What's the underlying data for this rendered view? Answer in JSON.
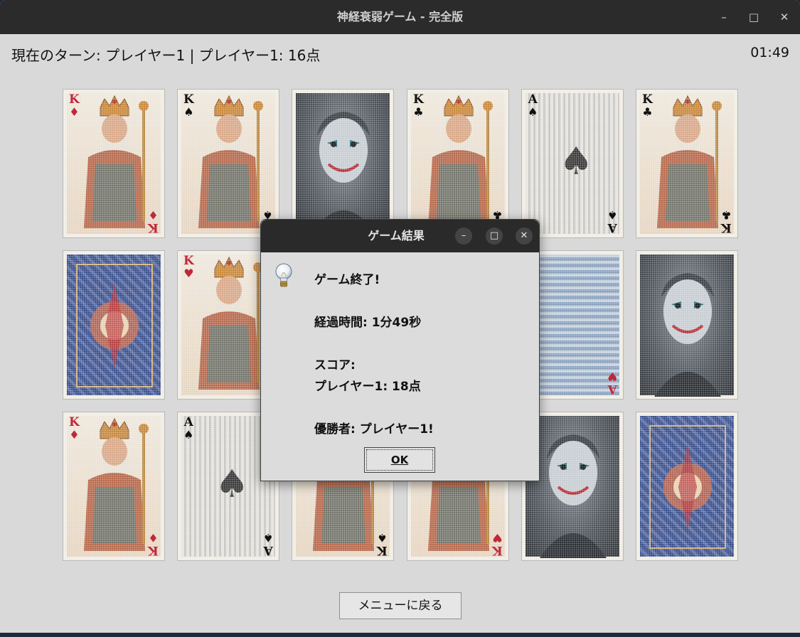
{
  "window": {
    "title": "神経衰弱ゲーム - 完全版",
    "minimize_glyph": "–",
    "maximize_glyph": "□",
    "close_glyph": "✕"
  },
  "status": {
    "turn_text": "現在のターン: プレイヤー1 | プレイヤー1: 16点",
    "timer": "01:49"
  },
  "cards": [
    {
      "kind": "king-face",
      "rank": "K",
      "suit": "♦",
      "suit_color": "#c0283a",
      "state": "revealed"
    },
    {
      "kind": "king-face",
      "rank": "K",
      "suit": "♠",
      "suit_color": "#111111",
      "state": "revealed"
    },
    {
      "kind": "joker-face",
      "state": "revealed"
    },
    {
      "kind": "king-face",
      "rank": "K",
      "suit": "♣",
      "suit_color": "#111111",
      "state": "revealed"
    },
    {
      "kind": "ace-spade",
      "rank": "A",
      "suit": "♠",
      "suit_color": "#111111",
      "state": "revealed"
    },
    {
      "kind": "king-face",
      "rank": "K",
      "suit": "♣",
      "suit_color": "#111111",
      "state": "revealed"
    },
    {
      "kind": "card-back",
      "state": "face-down"
    },
    {
      "kind": "king-face",
      "rank": "K",
      "suit": "♥",
      "suit_color": "#c0283a",
      "state": "revealed"
    },
    {
      "kind": "hidden",
      "state": "covered"
    },
    {
      "kind": "hidden",
      "state": "covered"
    },
    {
      "kind": "card-back-ornate",
      "rank": "A",
      "suit": "♥",
      "suit_color": "#c0283a",
      "state": "revealed"
    },
    {
      "kind": "joker-face",
      "state": "revealed"
    },
    {
      "kind": "king-face",
      "rank": "K",
      "suit": "♦",
      "suit_color": "#c0283a",
      "state": "revealed"
    },
    {
      "kind": "ace-spade",
      "rank": "A",
      "suit": "♠",
      "suit_color": "#111111",
      "state": "revealed"
    },
    {
      "kind": "king-face",
      "rank": "K",
      "suit": "♠",
      "suit_color": "#111111",
      "state": "revealed"
    },
    {
      "kind": "king-face",
      "rank": "K",
      "suit": "♥",
      "suit_color": "#c0283a",
      "state": "revealed"
    },
    {
      "kind": "joker-face",
      "state": "revealed"
    },
    {
      "kind": "card-back",
      "state": "face-down"
    }
  ],
  "dialog": {
    "title": "ゲーム結果",
    "minimize_glyph": "–",
    "maximize_glyph": "□",
    "close_glyph": "✕",
    "lines": {
      "game_over": "ゲーム終了!",
      "elapsed": "経過時間: 1分49秒",
      "score_label": "スコア:",
      "score_value": "プレイヤー1: 18点",
      "winner": "優勝者: プレイヤー1!"
    },
    "ok_label": "OK",
    "icon": "lightbulb-icon"
  },
  "menu_button_label": "メニューに戻る",
  "colors": {
    "window_bg": "#d9d9d9",
    "titlebar_bg": "#2b2b2b",
    "card_back_blue": "#3b4f8a",
    "joker_gray": "#5a5f66"
  }
}
